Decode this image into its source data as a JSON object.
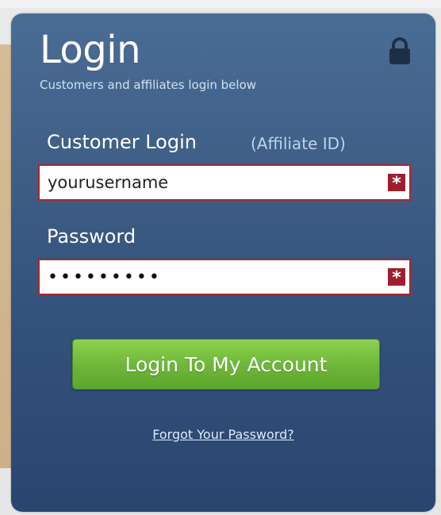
{
  "login_panel": {
    "title": "Login",
    "subtitle": "Customers and affiliates login below",
    "lock_icon": "lock-icon",
    "username": {
      "label": "Customer Login",
      "alt_link": "(Affiliate ID)",
      "value": "yourusername",
      "required_marker": "*"
    },
    "password": {
      "label": "Password",
      "value": "•••••••••",
      "required_marker": "*"
    },
    "submit_label": "Login To My Account",
    "forgot_link": "Forgot Your Password?"
  },
  "colors": {
    "panel_top": "#4a6d95",
    "panel_bottom": "#2a4670",
    "button_green": "#6fb83a",
    "required_red": "#9e1e2e",
    "input_border": "#a5282c"
  }
}
